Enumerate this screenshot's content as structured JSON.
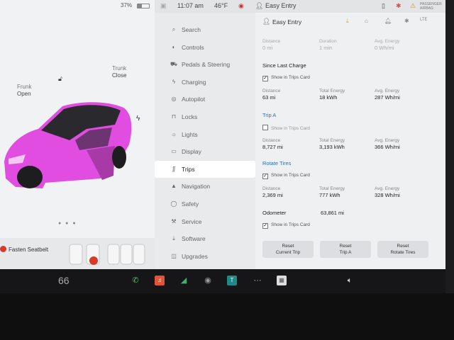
{
  "status": {
    "time": "11:07 am",
    "temperature": "46°F",
    "profile": "Easy Entry",
    "battery_percent": "37%",
    "battery_level": 0.37,
    "passenger_airbag_text": "PASSENGER AIRBAG"
  },
  "car": {
    "frunk_label": "Frunk",
    "frunk_state": "Open",
    "trunk_label": "Trunk",
    "trunk_state": "Close",
    "page_dots": "● ● ●",
    "seatbelt_warning": "Fasten Seatbelt",
    "body_color": "#e04de0"
  },
  "menu": {
    "items": [
      {
        "label": "Search",
        "icon": "search-icon",
        "glyph": "⌕"
      },
      {
        "label": "Controls",
        "icon": "toggle-icon",
        "glyph": "◐"
      },
      {
        "label": "Pedals & Steering",
        "icon": "car-icon",
        "glyph": "⛟"
      },
      {
        "label": "Charging",
        "icon": "bolt-icon",
        "glyph": "ϟ"
      },
      {
        "label": "Autopilot",
        "icon": "steering-wheel-icon",
        "glyph": "◎"
      },
      {
        "label": "Locks",
        "icon": "lock-icon",
        "glyph": "⊓"
      },
      {
        "label": "Lights",
        "icon": "light-icon",
        "glyph": "☼"
      },
      {
        "label": "Display",
        "icon": "display-icon",
        "glyph": "▭"
      },
      {
        "label": "Trips",
        "icon": "trips-icon",
        "glyph": "ʃʃ"
      },
      {
        "label": "Navigation",
        "icon": "navigation-icon",
        "glyph": "▲"
      },
      {
        "label": "Safety",
        "icon": "safety-icon",
        "glyph": "◯"
      },
      {
        "label": "Service",
        "icon": "wrench-icon",
        "glyph": "⚒"
      },
      {
        "label": "Software",
        "icon": "download-icon",
        "glyph": "⤓"
      },
      {
        "label": "Upgrades",
        "icon": "upgrades-icon",
        "glyph": "◫"
      }
    ],
    "active_index": 8
  },
  "content": {
    "header_title": "Easy Entry",
    "current": {
      "distance_label": "Distance",
      "distance": "0 mi",
      "duration_label": "Duration",
      "duration": "1 min",
      "energy_label": "Avg. Energy",
      "energy": "0 Wh/mi"
    },
    "since_charge": {
      "title": "Since Last Charge",
      "show_label": "Show in Trips Card",
      "checked": true,
      "distance_label": "Distance",
      "distance": "63 mi",
      "total_label": "Total Energy",
      "total": "18 kWh",
      "avg_label": "Avg. Energy",
      "avg": "287 Wh/mi"
    },
    "trip_a": {
      "title": "Trip A",
      "show_label": "Show in Trips Card",
      "checked": false,
      "distance_label": "Distance",
      "distance": "8,727 mi",
      "total_label": "Total Energy",
      "total": "3,193 kWh",
      "avg_label": "Avg. Energy",
      "avg": "366 Wh/mi"
    },
    "rotate_tires": {
      "title": "Rotate Tires",
      "show_label": "Show in Trips Card",
      "checked": true,
      "distance_label": "Distance",
      "distance": "2,369 mi",
      "total_label": "Total Energy",
      "total": "777 kWh",
      "avg_label": "Avg. Energy",
      "avg": "328 Wh/mi"
    },
    "odometer": {
      "label": "Odometer",
      "value": "63,861 mi",
      "show_label": "Show in Trips Card",
      "checked": true
    },
    "buttons": {
      "reset_current": "Reset\nCurrent Trip",
      "reset_a": "Reset\nTrip A",
      "reset_tires": "Reset\nRotate Tires"
    }
  },
  "taskbar": {
    "cabin_temp": "66",
    "more_glyph": "···"
  },
  "colors": {
    "accent": "#2e6fbd",
    "warning": "#d63b2a"
  }
}
